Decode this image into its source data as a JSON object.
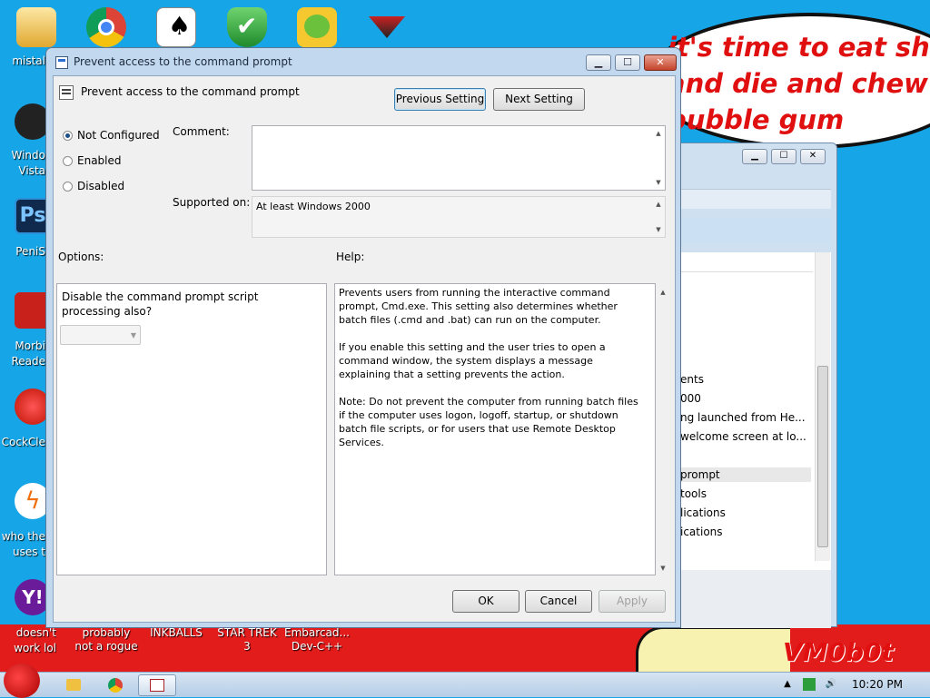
{
  "wallpaper": {
    "bubble_lines": [
      "it's time to eat shit",
      "and die and chew",
      "bubble gum"
    ],
    "signature": "VM0b0t"
  },
  "desktop": {
    "left_labels": [
      {
        "top": "mistal",
        "bottom": ""
      },
      {
        "top": "Windo",
        "bottom": "Vista"
      },
      {
        "top": "PeniS",
        "bottom": ""
      },
      {
        "top": "Morbi",
        "bottom": "Reade"
      },
      {
        "top": "CockCle",
        "bottom": ""
      },
      {
        "top": "who the",
        "bottom": "uses t"
      },
      {
        "top": "doesn't",
        "bottom": "work lol"
      }
    ],
    "bottom_labels": [
      {
        "line1": "probably",
        "line2": "not a rogue"
      },
      {
        "line1": "INKBALLS",
        "line2": ""
      },
      {
        "line1": "STAR TREK",
        "line2": "3"
      },
      {
        "line1": "Embarcad...",
        "line2": "Dev-C++"
      }
    ],
    "top_icons": [
      "folder-icon",
      "chrome-icon",
      "solitaire-icon",
      "security-shield-icon",
      "bad-piggies-icon",
      "app-logo-icon"
    ]
  },
  "bg_window": {
    "rows": [
      "ents",
      "000",
      "ng launched from He...",
      "welcome screen at lo...",
      "prompt",
      "tools",
      "lications",
      "ications"
    ]
  },
  "dialog": {
    "title": "Prevent access to the command prompt",
    "setting_name": "Prevent access to the command prompt",
    "prev_label": "Previous Setting",
    "next_label": "Next Setting",
    "radio_not_configured": "Not Configured",
    "radio_enabled": "Enabled",
    "radio_disabled": "Disabled",
    "comment_label": "Comment:",
    "supported_label": "Supported on:",
    "supported_value": "At least Windows 2000",
    "options_label": "Options:",
    "help_label": "Help:",
    "option_text": "Disable the command prompt script processing also?",
    "help_p1": "Prevents users from running the interactive command prompt, Cmd.exe. This setting also determines whether batch files (.cmd and .bat) can run on the computer.",
    "help_p2": "If you enable this setting and the user tries to open a command window, the system displays a message explaining that a setting prevents the action.",
    "help_p3": "Note: Do not prevent the computer from running batch files if the computer uses logon, logoff, startup, or shutdown batch file scripts, or for users that use Remote Desktop Services.",
    "ok_label": "OK",
    "cancel_label": "Cancel",
    "apply_label": "Apply"
  },
  "taskbar": {
    "clock": "10:20 PM"
  },
  "colors": {
    "desktop": "#16a5e6",
    "wallpaper_red": "#e21b1b",
    "bubble_text": "#e01010"
  }
}
